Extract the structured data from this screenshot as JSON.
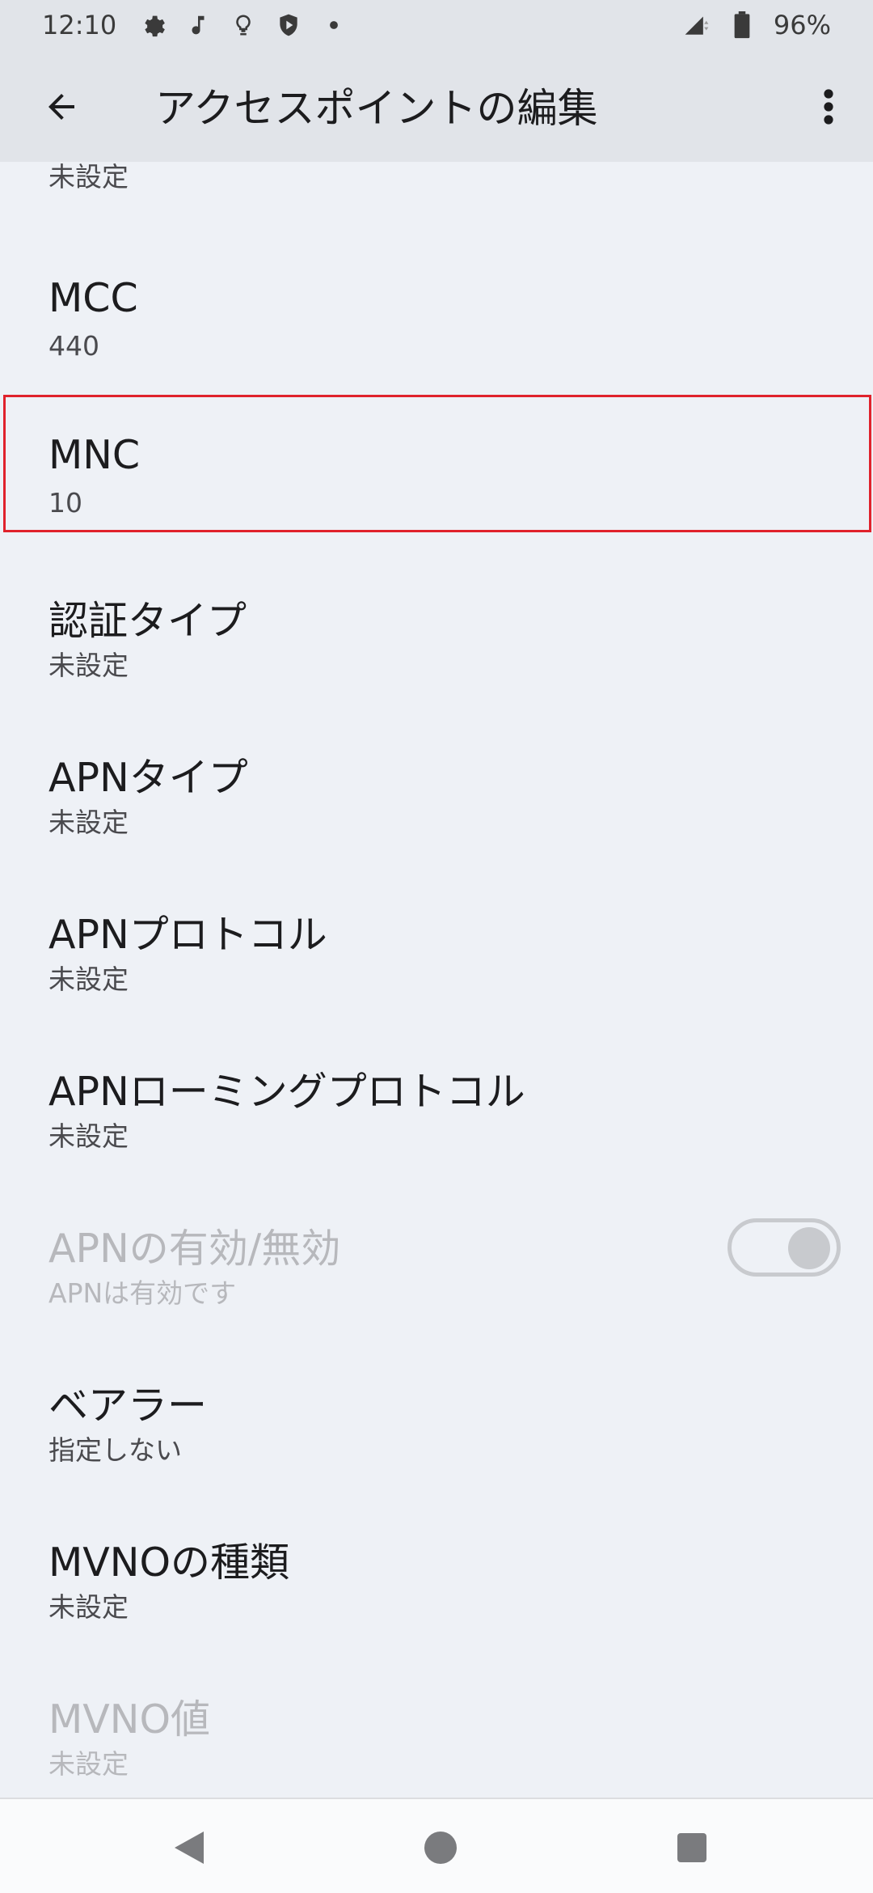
{
  "status_bar": {
    "time": "12:10",
    "battery": "96%",
    "icons": [
      "gear-icon",
      "music-note-icon",
      "lightbulb-icon",
      "shield-icon",
      "dot-icon",
      "signal-icon",
      "battery-icon"
    ]
  },
  "app_bar": {
    "title": "アクセスポイントの編集"
  },
  "top_partial": {
    "subtitle": "未設定"
  },
  "items": [
    {
      "title": "MCC",
      "subtitle": "440"
    },
    {
      "title": "MNC",
      "subtitle": "10"
    },
    {
      "title": "認証タイプ",
      "subtitle": "未設定"
    },
    {
      "title": "APNタイプ",
      "subtitle": "未設定"
    },
    {
      "title": "APNプロトコル",
      "subtitle": "未設定"
    },
    {
      "title": "APNローミングプロトコル",
      "subtitle": "未設定"
    },
    {
      "title": "APNの有効/無効",
      "subtitle": "APNは有効です",
      "toggle_on": true,
      "enabled": false
    },
    {
      "title": "ベアラー",
      "subtitle": "指定しない"
    },
    {
      "title": "MVNOの種類",
      "subtitle": "未設定"
    },
    {
      "title": "MVNO値",
      "subtitle": "未設定",
      "enabled": false
    }
  ],
  "colors": {
    "background": "#eef1f6",
    "app_bar": "#e1e4e9",
    "highlight_border": "#e0222c",
    "disabled_text": "#b7b8bc"
  }
}
